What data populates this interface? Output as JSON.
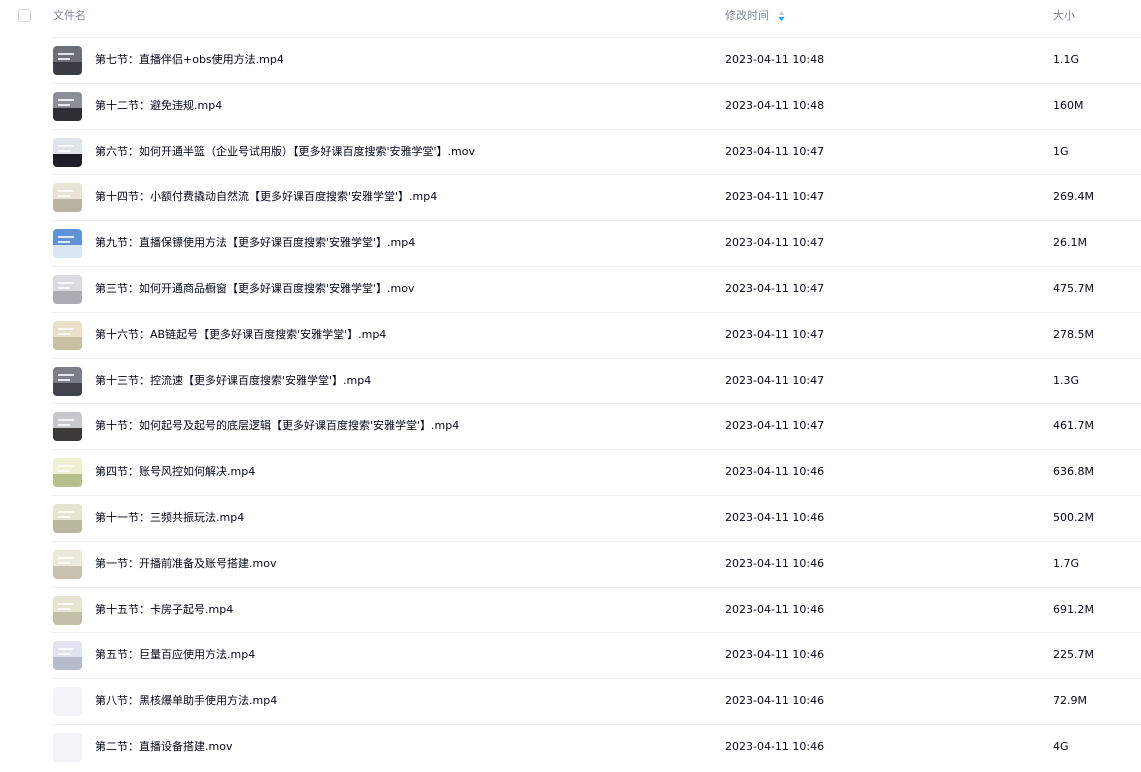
{
  "header": {
    "name_label": "文件名",
    "time_label": "修改时间",
    "size_label": "大小"
  },
  "accent_color": "#06a7ff",
  "files": [
    {
      "name": "第七节：直播伴侣+obs使用方法.mp4",
      "modified": "2023-04-11 10:48",
      "size": "1.1G",
      "thumb": [
        "#6b6f78",
        "#3a3d44"
      ]
    },
    {
      "name": "第十二节：避免违规.mp4",
      "modified": "2023-04-11 10:48",
      "size": "160M",
      "thumb": [
        "#8a8e96",
        "#2d2f35"
      ]
    },
    {
      "name": "第六节：如何开通半篮（企业号试用版）【更多好课百度搜索'安雅学堂'】.mov",
      "modified": "2023-04-11 10:47",
      "size": "1G",
      "thumb": [
        "#dfe3ea",
        "#1c1f27"
      ]
    },
    {
      "name": "第十四节：小额付费撬动自然流【更多好课百度搜索'安雅学堂'】.mp4",
      "modified": "2023-04-11 10:47",
      "size": "269.4M",
      "thumb": [
        "#e9e4d6",
        "#b9b3a3"
      ]
    },
    {
      "name": "第九节：直播保镖使用方法【更多好课百度搜索'安雅学堂'】.mp4",
      "modified": "2023-04-11 10:47",
      "size": "26.1M",
      "thumb": [
        "#5f93d6",
        "#dce7f5"
      ]
    },
    {
      "name": "第三节：如何开通商品橱窗【更多好课百度搜索'安雅学堂'】.mov",
      "modified": "2023-04-11 10:47",
      "size": "475.7M",
      "thumb": [
        "#d9dbe0",
        "#a9acb3"
      ]
    },
    {
      "name": "第十六节：AB链起号【更多好课百度搜索'安雅学堂'】.mp4",
      "modified": "2023-04-11 10:47",
      "size": "278.5M",
      "thumb": [
        "#e8e1c8",
        "#c8c0a2"
      ]
    },
    {
      "name": "第十三节：控流速【更多好课百度搜索'安雅学堂'】.mp4",
      "modified": "2023-04-11 10:47",
      "size": "1.3G",
      "thumb": [
        "#7a7e88",
        "#40434b"
      ]
    },
    {
      "name": "第十节：如何起号及起号的底层逻辑【更多好课百度搜索'安雅学堂'】.mp4",
      "modified": "2023-04-11 10:47",
      "size": "461.7M",
      "thumb": [
        "#c6c8cc",
        "#3c3a36"
      ]
    },
    {
      "name": "第四节：账号风控如何解决.mp4",
      "modified": "2023-04-11 10:46",
      "size": "636.8M",
      "thumb": [
        "#eef0cf",
        "#b6c08a"
      ]
    },
    {
      "name": "第十一节：三频共振玩法.mp4",
      "modified": "2023-04-11 10:46",
      "size": "500.2M",
      "thumb": [
        "#e6e4cf",
        "#b9b79e"
      ]
    },
    {
      "name": "第一节：开播前准备及账号搭建.mov",
      "modified": "2023-04-11 10:46",
      "size": "1.7G",
      "thumb": [
        "#ece8dc",
        "#c9c2b0"
      ]
    },
    {
      "name": "第十五节：卡房子起号.mp4",
      "modified": "2023-04-11 10:46",
      "size": "691.2M",
      "thumb": [
        "#e7e4d2",
        "#c4bfa8"
      ]
    },
    {
      "name": "第五节：巨量百应使用方法.mp4",
      "modified": "2023-04-11 10:46",
      "size": "225.7M",
      "thumb": [
        "#dfe4ee",
        "#b6bccb"
      ]
    },
    {
      "name": "第八节：黑核爆单助手使用方法.mp4",
      "modified": "2023-04-11 10:46",
      "size": "72.9M",
      "thumb": [
        "#f3f4f8",
        "#f3f4f8"
      ]
    },
    {
      "name": "第二节：直播设备搭建.mov",
      "modified": "2023-04-11 10:46",
      "size": "4G",
      "thumb": [
        "#f3f4f8",
        "#f3f4f8"
      ]
    }
  ]
}
